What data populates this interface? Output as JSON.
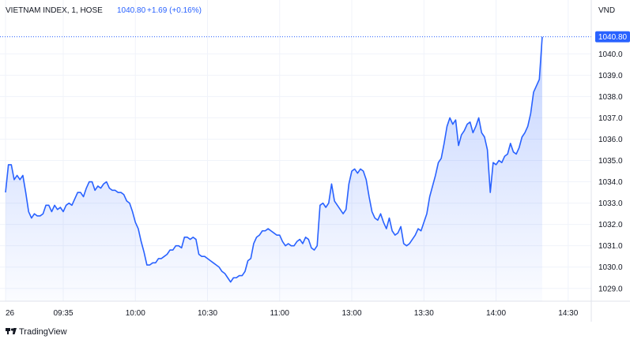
{
  "header": {
    "symbol": "VIETNAM INDEX, 1, HOSE",
    "last": "1040.80",
    "change": "+1.69 (+0.16%)"
  },
  "currency": "VND",
  "brand": "TradingView",
  "colors": {
    "line": "#2962ff",
    "grid": "#f0f3fa",
    "last_label_bg": "#2962ff",
    "text": "#131722",
    "separator": "#e0e3eb"
  },
  "chart_data": {
    "type": "area",
    "title": "VIETNAM INDEX, 1, HOSE",
    "ylim": [
      1028.4,
      1041.6
    ],
    "y_ticks": [
      1029.0,
      1030.0,
      1031.0,
      1032.0,
      1033.0,
      1034.0,
      1035.0,
      1036.0,
      1037.0,
      1038.0,
      1039.0,
      1040.0
    ],
    "y_tick_labels": [
      "1029.0",
      "1030.0",
      "1031.0",
      "1032.0",
      "1033.0",
      "1034.0",
      "1035.0",
      "1036.0",
      "1037.0",
      "1038.0",
      "1039.0",
      "1040.0"
    ],
    "x_ticks": [
      0,
      20,
      45,
      70,
      95,
      120,
      145,
      170,
      195
    ],
    "x_tick_labels": [
      "26",
      "09:35",
      "10:00",
      "10:30",
      "11:00",
      "13:00",
      "13:30",
      "14:00",
      "14:30"
    ],
    "xlim": [
      0,
      203
    ],
    "last_value": 1040.8,
    "last_value_label": "1040.80",
    "grid": true,
    "series": [
      {
        "values": [
          1033.5,
          1034.8,
          1034.8,
          1034.1,
          1034.3,
          1034.1,
          1034.3,
          1033.5,
          1032.6,
          1032.3,
          1032.5,
          1032.4,
          1032.4,
          1032.5,
          1032.9,
          1032.9,
          1032.6,
          1032.9,
          1032.7,
          1032.8,
          1032.6,
          1032.9,
          1033.0,
          1032.9,
          1033.2,
          1033.5,
          1033.5,
          1033.3,
          1033.7,
          1034.0,
          1034.0,
          1033.6,
          1033.8,
          1033.7,
          1033.9,
          1034.0,
          1033.7,
          1033.6,
          1033.6,
          1033.5,
          1033.5,
          1033.4,
          1033.1,
          1033.0,
          1032.6,
          1032.1,
          1031.8,
          1031.2,
          1030.7,
          1030.1,
          1030.1,
          1030.2,
          1030.2,
          1030.4,
          1030.4,
          1030.5,
          1030.6,
          1030.8,
          1030.8,
          1031.0,
          1031.0,
          1030.9,
          1031.4,
          1031.4,
          1031.3,
          1031.4,
          1031.3,
          1030.6,
          1030.5,
          1030.5,
          1030.4,
          1030.3,
          1030.2,
          1030.1,
          1030.0,
          1029.8,
          1029.7,
          1029.5,
          1029.3,
          1029.5,
          1029.5,
          1029.6,
          1029.6,
          1029.8,
          1030.3,
          1030.4,
          1031.1,
          1031.4,
          1031.5,
          1031.7,
          1031.7,
          1031.8,
          1031.7,
          1031.6,
          1031.5,
          1031.5,
          1031.2,
          1031.0,
          1031.1,
          1031.0,
          1031.0,
          1031.2,
          1031.3,
          1031.1,
          1031.4,
          1031.3,
          1030.9,
          1030.8,
          1031.0,
          1032.9,
          1033.0,
          1032.8,
          1033.0,
          1033.9,
          1033.1,
          1032.9,
          1032.7,
          1032.5,
          1032.7,
          1033.9,
          1034.5,
          1034.6,
          1034.4,
          1034.6,
          1034.5,
          1034.1,
          1033.3,
          1032.6,
          1032.3,
          1032.2,
          1032.5,
          1032.1,
          1031.8,
          1032.3,
          1031.7,
          1031.5,
          1031.6,
          1031.9,
          1031.1,
          1031.0,
          1031.1,
          1031.3,
          1031.5,
          1031.8,
          1031.7,
          1032.1,
          1032.5,
          1033.3,
          1033.8,
          1034.3,
          1034.9,
          1035.1,
          1035.8,
          1036.6,
          1037.0,
          1036.7,
          1036.9,
          1035.7,
          1036.2,
          1036.4,
          1036.7,
          1036.8,
          1036.3,
          1036.6,
          1037.0,
          1036.3,
          1036.1,
          1035.5,
          1033.5,
          1034.9,
          1034.8,
          1035.0,
          1034.9,
          1035.2,
          1035.3,
          1035.8,
          1035.4,
          1035.3,
          1035.6,
          1036.1,
          1036.3,
          1036.6,
          1037.2,
          1038.2,
          1038.5,
          1038.8,
          1040.8
        ]
      }
    ]
  }
}
